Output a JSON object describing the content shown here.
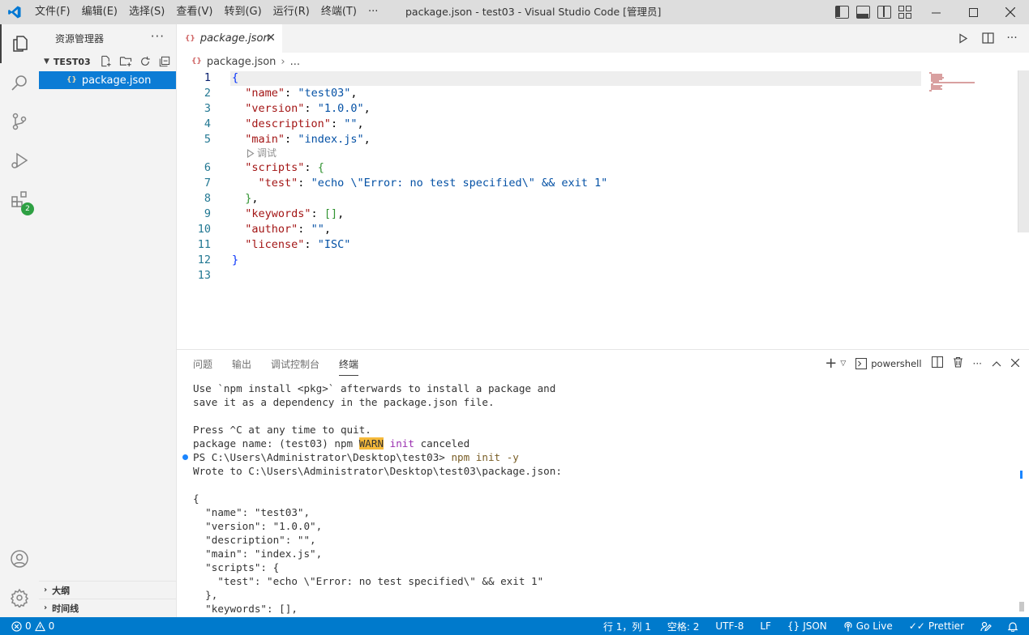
{
  "window": {
    "title": "package.json - test03 - Visual Studio Code [管理员]",
    "menu": [
      "文件(F)",
      "编辑(E)",
      "选择(S)",
      "查看(V)",
      "转到(G)",
      "运行(R)",
      "终端(T)",
      "···"
    ]
  },
  "activity": {
    "extensions_badge": "2"
  },
  "sidebar": {
    "title": "资源管理器",
    "more": "···",
    "folder": "TEST03",
    "file": "package.json",
    "sections": [
      "大纲",
      "时间线"
    ]
  },
  "editor": {
    "tab_label": "package.json",
    "breadcrumb_file": "package.json",
    "breadcrumb_more": "...",
    "codelens": "调试",
    "line_numbers": [
      "1",
      "2",
      "3",
      "4",
      "5",
      "6",
      "7",
      "8",
      "9",
      "10",
      "11",
      "12",
      "13"
    ]
  },
  "panel": {
    "tabs": [
      "问题",
      "输出",
      "调试控制台",
      "终端"
    ],
    "active_tab": "终端",
    "terminal_name": "powershell",
    "lines": [
      "Use `npm install <pkg>` afterwards to install a package and",
      "save it as a dependency in the package.json file.",
      "",
      "Press ^C at any time to quit.",
      "package name: (test03) npm ",
      "WARN",
      " init",
      " canceled",
      "PS C:\\Users\\Administrator\\Desktop\\test03> ",
      "npm init -y",
      "Wrote to C:\\Users\\Administrator\\Desktop\\test03\\package.json:",
      "",
      "{",
      "  \"name\": \"test03\",",
      "  \"version\": \"1.0.0\",",
      "  \"description\": \"\",",
      "  \"main\": \"index.js\",",
      "  \"scripts\": {",
      "    \"test\": \"echo \\\"Error: no test specified\\\" && exit 1\"",
      "  },",
      "  \"keywords\": [],"
    ]
  },
  "statusbar": {
    "errors": "0",
    "warnings": "0",
    "position": "行 1，列 1",
    "indent": "空格: 2",
    "encoding": "UTF-8",
    "eol": "LF",
    "language": "JSON",
    "golive": "Go Live",
    "prettier": "Prettier"
  },
  "colors": {
    "statusbar": "#007acc",
    "selection": "#0c7cd5",
    "badge": "#2ea043"
  }
}
